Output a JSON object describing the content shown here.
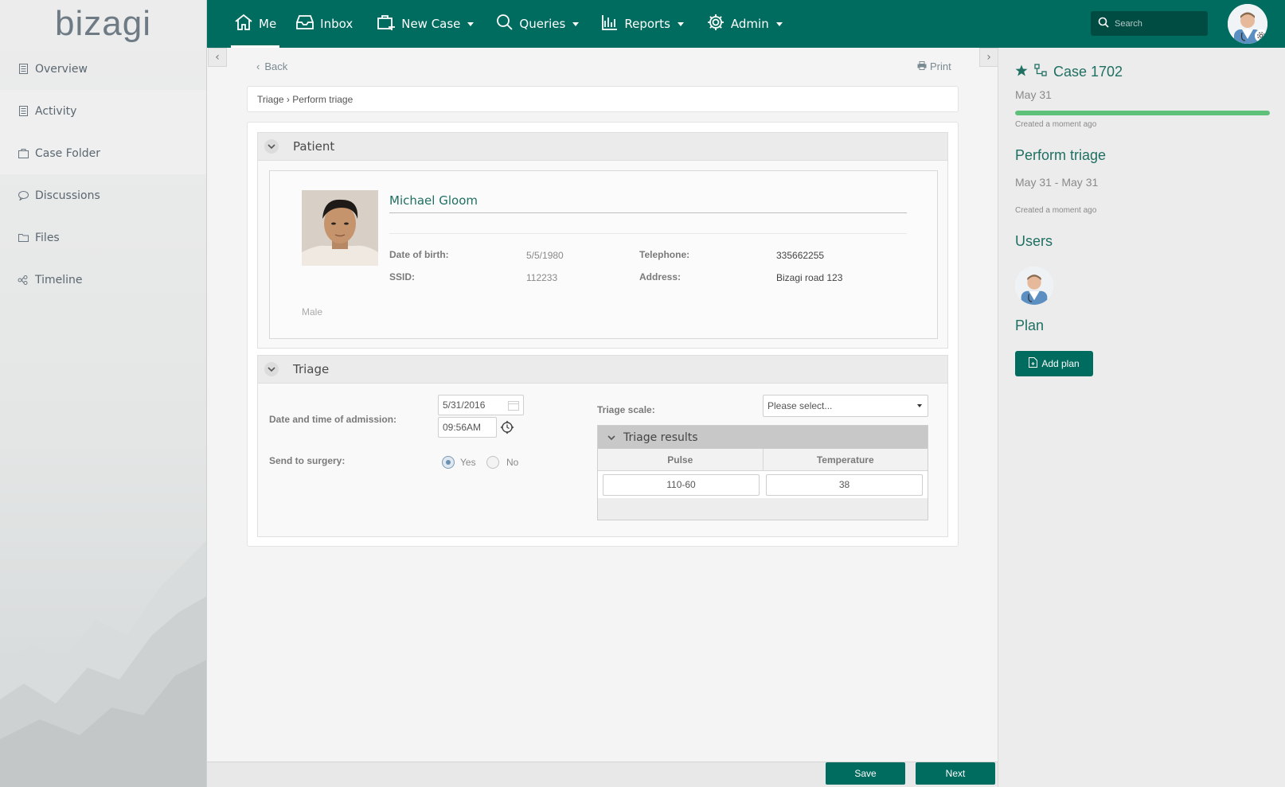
{
  "app": {
    "logo": "bizagi"
  },
  "sidebar": {
    "items": [
      {
        "label": "Overview",
        "icon": "document-icon"
      },
      {
        "label": "Activity",
        "icon": "document-icon"
      },
      {
        "label": "Case Folder",
        "icon": "folder-icon"
      },
      {
        "label": "Discussions",
        "icon": "chat-bubble-icon"
      },
      {
        "label": "Files",
        "icon": "folder-icon"
      },
      {
        "label": "Timeline",
        "icon": "timeline-icon"
      }
    ]
  },
  "topnav": {
    "items": [
      {
        "label": "Me",
        "icon": "home-icon"
      },
      {
        "label": "Inbox",
        "icon": "inbox-icon"
      },
      {
        "label": "New Case",
        "icon": "new-case-icon"
      },
      {
        "label": "Queries",
        "icon": "search-icon"
      },
      {
        "label": "Reports",
        "icon": "chart-icon"
      },
      {
        "label": "Admin",
        "icon": "gear-icon"
      }
    ],
    "search_placeholder": "Search",
    "accent": "#006c5f"
  },
  "main": {
    "back_label": "Back",
    "print_label": "Print",
    "breadcrumb": "Triage › Perform triage",
    "patient": {
      "section_title": "Patient",
      "name": "Michael Gloom",
      "dob_label": "Date of birth:",
      "dob_value": "5/5/1980",
      "ssid_label": "SSID:",
      "ssid_value": "112233",
      "telephone_label": "Telephone:",
      "telephone_value": "335662255",
      "address_label": "Address:",
      "address_value": "Bizagi road 123",
      "gender": "Male"
    },
    "triage": {
      "section_title": "Triage",
      "admission_label": "Date and time of admission:",
      "admission_date": "5/31/2016",
      "admission_time": "09:56AM",
      "surgery_label": "Send to surgery:",
      "surgery_yes": "Yes",
      "surgery_no": "No",
      "surgery_selected": "Yes",
      "scale_label": "Triage scale:",
      "scale_placeholder": "Please select...",
      "results": {
        "title": "Triage results",
        "columns": [
          "Pulse",
          "Temperature"
        ],
        "rows": [
          [
            "110-60",
            "38"
          ]
        ]
      }
    }
  },
  "rightpanel": {
    "case_title": "Case 1702",
    "case_date": "May 31",
    "case_progress": 1.0,
    "case_created": "Created a moment ago",
    "task_title": "Perform triage",
    "task_dates": "May 31 - May 31",
    "task_created": "Created a moment ago",
    "users_title": "Users",
    "plan_title": "Plan",
    "add_plan_label": "Add plan"
  },
  "footer": {
    "save_label": "Save",
    "next_label": "Next"
  }
}
